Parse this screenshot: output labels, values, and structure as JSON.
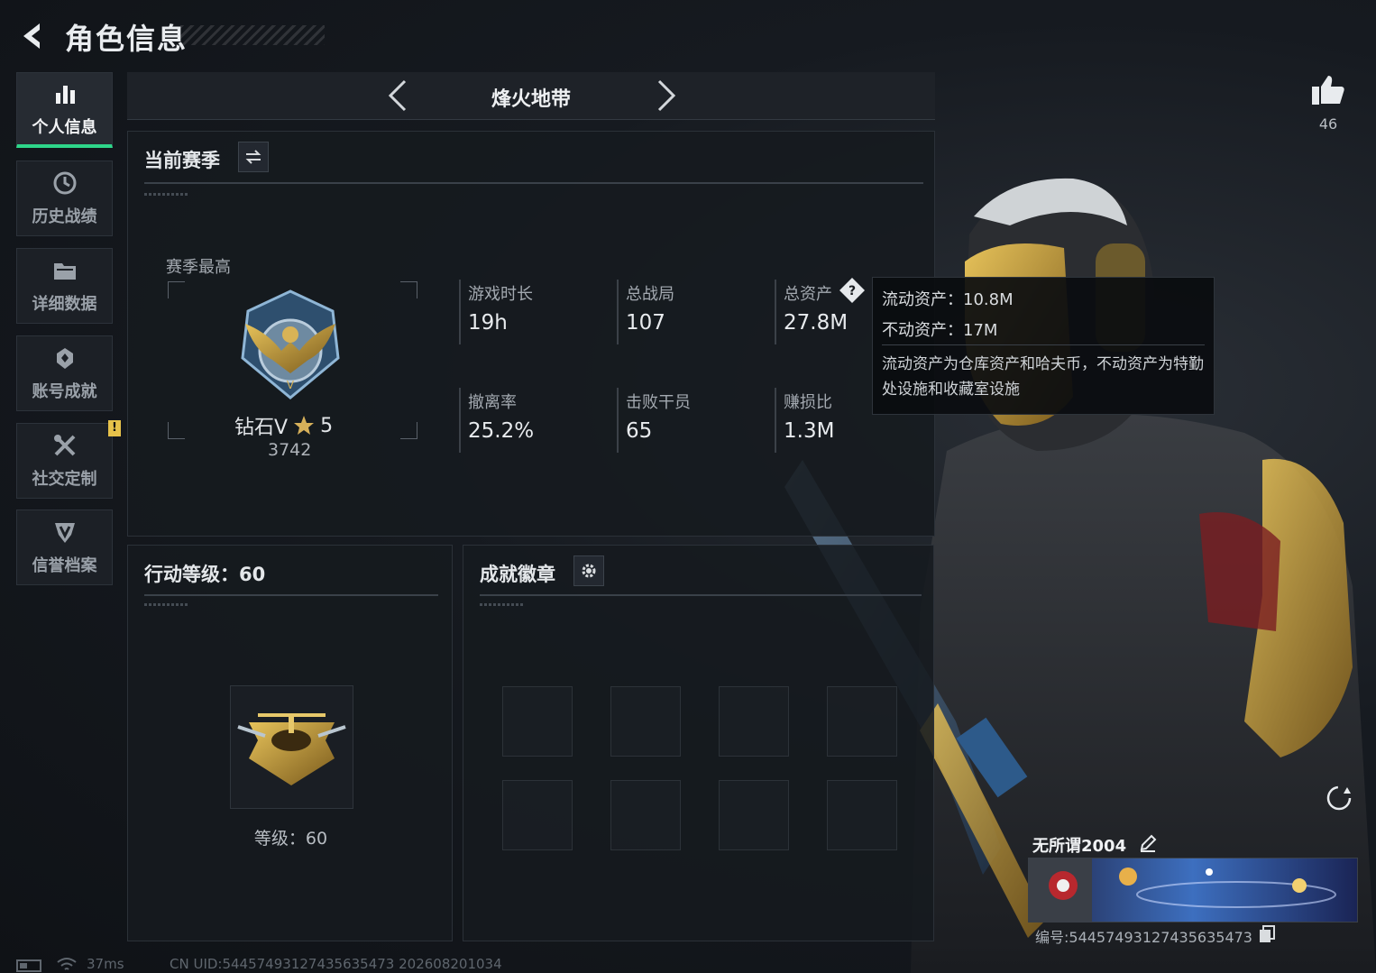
{
  "header": {
    "title": "角色信息"
  },
  "sidebar": {
    "items": [
      {
        "label": "个人信息",
        "icon": "bar-chart-icon",
        "active": true
      },
      {
        "label": "历史战绩",
        "icon": "history-clock-icon"
      },
      {
        "label": "详细数据",
        "icon": "folder-icon"
      },
      {
        "label": "账号成就",
        "icon": "achievement-icon"
      },
      {
        "label": "社交定制",
        "icon": "tools-icon",
        "badge": "!"
      },
      {
        "label": "信誉档案",
        "icon": "shield-v-icon"
      }
    ]
  },
  "mode": {
    "title": "烽火地带"
  },
  "season": {
    "title": "当前赛季",
    "best_label": "赛季最高",
    "rank_name": "钻石V",
    "rank_stars": "5",
    "rank_score": "3742",
    "stats": [
      {
        "label": "游戏时长",
        "value": "19h"
      },
      {
        "label": "总战局",
        "value": "107"
      },
      {
        "label": "总资产",
        "value": "27.8M"
      },
      {
        "label": "撤离率",
        "value": "25.2%"
      },
      {
        "label": "击败干员",
        "value": "65"
      },
      {
        "label": "赚损比",
        "value": "1.3M"
      }
    ]
  },
  "tooltip": {
    "liquid": "流动资产：10.8M",
    "fixed": "不动资产：17M",
    "desc": "流动资产为仓库资产和哈夫币，不动资产为特勤处设施和收藏室设施"
  },
  "action_level": {
    "title": "行动等级：60",
    "level_text": "等级：60"
  },
  "achievements": {
    "title": "成就徽章"
  },
  "likes": {
    "count": "46"
  },
  "player": {
    "name": "无所谓2004",
    "id_text": "编号:5445749312743563547​3"
  },
  "status_bar": {
    "ping": "37ms",
    "uid": "CN UID:5445749312743563547​3 202608201034"
  },
  "colors": {
    "accent": "#2ed68a",
    "warning": "#e7c24a",
    "gold": "#c9a13b"
  }
}
